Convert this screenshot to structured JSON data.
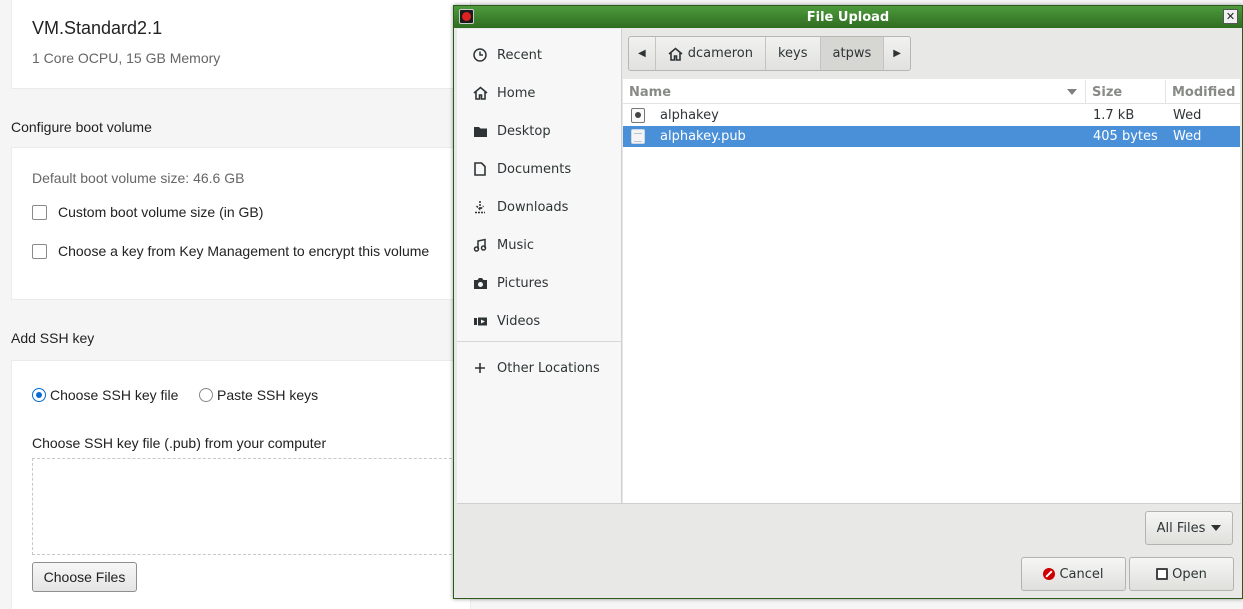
{
  "background_page": {
    "shape": {
      "name": "VM.Standard2.1",
      "description": "1 Core OCPU, 15 GB Memory"
    },
    "boot_volume": {
      "section_title": "Configure boot volume",
      "default_size_text": "Default boot volume size: 46.6 GB",
      "custom_size_label": "Custom boot volume size (in GB)",
      "encrypt_label": "Choose a key from Key Management to encrypt this volume",
      "custom_size_checked": false,
      "encrypt_checked": false
    },
    "ssh": {
      "section_title": "Add SSH key",
      "radio_file_label": "Choose SSH key file",
      "radio_paste_label": "Paste SSH keys",
      "selected_option": "Choose SSH key file",
      "file_prompt": "Choose SSH key file (.pub) from your computer",
      "choose_files_button": "Choose Files"
    }
  },
  "dialog": {
    "title": "File Upload",
    "close_glyph": "✕",
    "sidebar": {
      "items": [
        {
          "label": "Recent",
          "icon": "clock-icon"
        },
        {
          "label": "Home",
          "icon": "home-icon"
        },
        {
          "label": "Desktop",
          "icon": "folder-icon"
        },
        {
          "label": "Documents",
          "icon": "document-icon"
        },
        {
          "label": "Downloads",
          "icon": "download-icon"
        },
        {
          "label": "Music",
          "icon": "music-icon"
        },
        {
          "label": "Pictures",
          "icon": "camera-icon"
        },
        {
          "label": "Videos",
          "icon": "video-icon"
        }
      ],
      "other_locations": {
        "label": "Other Locations",
        "icon": "plus-icon"
      }
    },
    "pathbar": {
      "crumbs": [
        "dcameron",
        "keys",
        "atpws"
      ],
      "active": "atpws"
    },
    "columns": {
      "name": "Name",
      "size": "Size",
      "modified": "Modified"
    },
    "files": [
      {
        "name": "alphakey",
        "size": "1.7 kB",
        "modified": "Wed",
        "icon": "key-file-icon",
        "selected": false
      },
      {
        "name": "alphakey.pub",
        "size": "405 bytes",
        "modified": "Wed",
        "icon": "text-file-icon",
        "selected": true
      }
    ],
    "filter_button": "All Files",
    "cancel_button": "Cancel",
    "open_button": "Open",
    "colors": {
      "titlebar": "#3f8430",
      "selection": "#4a90d9"
    }
  }
}
